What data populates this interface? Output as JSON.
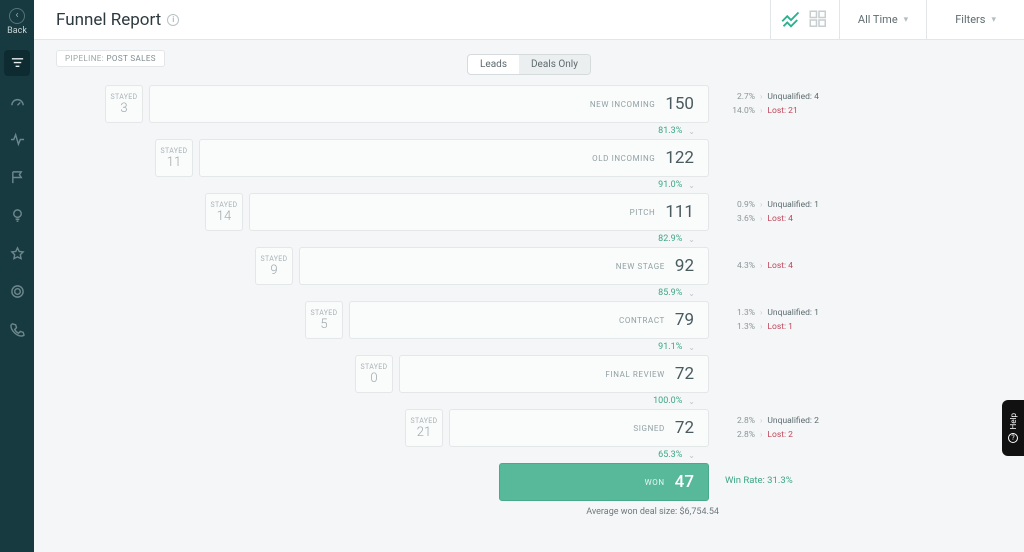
{
  "header": {
    "back": "Back",
    "title": "Funnel Report",
    "all_time": "All Time",
    "filters": "Filters"
  },
  "pipeline": {
    "label": "PIPELINE:",
    "value": "POST SALES"
  },
  "tabs": {
    "leads": "Leads",
    "deals": "Deals Only"
  },
  "chart_data": {
    "type": "bar",
    "title": "Funnel Report",
    "pipeline": "POST SALES",
    "stages": [
      {
        "name": "NEW INCOMING",
        "count": 150,
        "stayed": 3,
        "conversion_to_next_pct": 81.3,
        "outflows": [
          {
            "pct": 2.7,
            "label": "Unqualified",
            "n": 4
          },
          {
            "pct": 14.0,
            "label": "Lost",
            "n": 21
          }
        ]
      },
      {
        "name": "OLD INCOMING",
        "count": 122,
        "stayed": 11,
        "conversion_to_next_pct": 91.0,
        "outflows": []
      },
      {
        "name": "PITCH",
        "count": 111,
        "stayed": 14,
        "conversion_to_next_pct": 82.9,
        "outflows": [
          {
            "pct": 0.9,
            "label": "Unqualified",
            "n": 1
          },
          {
            "pct": 3.6,
            "label": "Lost",
            "n": 4
          }
        ]
      },
      {
        "name": "NEW STAGE",
        "count": 92,
        "stayed": 9,
        "conversion_to_next_pct": 85.9,
        "outflows": [
          {
            "pct": 4.3,
            "label": "Lost",
            "n": 4
          }
        ]
      },
      {
        "name": "CONTRACT",
        "count": 79,
        "stayed": 5,
        "conversion_to_next_pct": 91.1,
        "outflows": [
          {
            "pct": 1.3,
            "label": "Unqualified",
            "n": 1
          },
          {
            "pct": 1.3,
            "label": "Lost",
            "n": 1
          }
        ]
      },
      {
        "name": "FINAL REVIEW",
        "count": 72,
        "stayed": 0,
        "conversion_to_next_pct": 100.0,
        "outflows": []
      },
      {
        "name": "SIGNED",
        "count": 72,
        "stayed": 21,
        "conversion_to_next_pct": 65.3,
        "outflows": [
          {
            "pct": 2.8,
            "label": "Unqualified",
            "n": 2
          },
          {
            "pct": 2.8,
            "label": "Lost",
            "n": 2
          }
        ]
      }
    ],
    "won": {
      "name": "WON",
      "count": 47,
      "win_rate_pct": 31.3
    },
    "avg_deal_size": "$6,754.54"
  },
  "labels": {
    "stayed": "STAYED",
    "won": "WON",
    "win_rate": "Win Rate:",
    "avg": "Average won deal size:",
    "help": "Help"
  },
  "colors": {
    "accent": "#57b99a",
    "lost": "#c0475c"
  }
}
